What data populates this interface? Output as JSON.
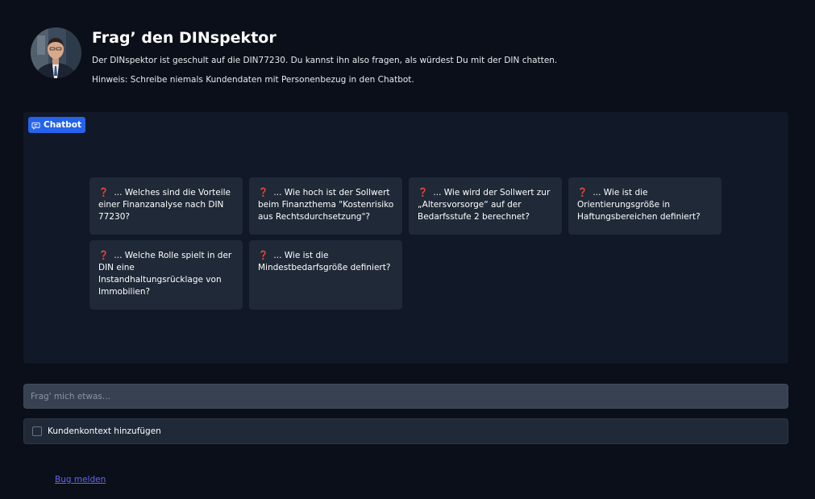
{
  "header": {
    "title": "Frag’ den DINspektor",
    "description": "Der DINspektor ist geschult auf die DIN77230. Du kannst ihn also fragen, als würdest Du mit der DIN chatten.",
    "hint": "Hinweis: Schreibe niemals Kundendaten mit Personenbezug in den Chatbot."
  },
  "chatbot": {
    "label": "Chatbot",
    "icon": "chat-bubble-icon",
    "question_icon": "❓",
    "examples": [
      {
        "text": " ... Welches sind die Vorteile einer Finanzanalyse nach DIN 77230?"
      },
      {
        "text": " ... Wie hoch ist der Sollwert beim Finanzthema \"Kostenrisiko aus Rechtsdurchsetzung\"?"
      },
      {
        "text": " ... Wie wird der Sollwert zur „Altersvorsorge“ auf der Bedarfsstufe 2 berechnet?"
      },
      {
        "text": " ... Wie ist die Orientierungsgröße in Haftungsbereichen definiert?"
      },
      {
        "text": " ... Welche Rolle spielt in der DIN eine Instandhaltungsrücklage von Immobilien?"
      },
      {
        "text": " ... Wie ist die Mindestbedarfsgröße definiert?"
      }
    ]
  },
  "input": {
    "placeholder": "Frag' mich etwas...",
    "value": ""
  },
  "context": {
    "label": "Kundenkontext hinzufügen",
    "checked": false
  },
  "footer": {
    "bug_link": "Bug melden"
  },
  "colors": {
    "background": "#0b0f19",
    "panel": "#111827",
    "card": "#1f2937",
    "accent": "#2563eb",
    "link": "#6366f1",
    "question": "#e11d48"
  }
}
